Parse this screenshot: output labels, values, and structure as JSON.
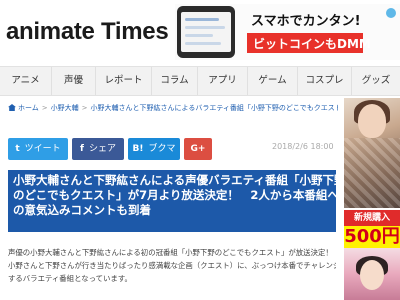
{
  "header": {
    "logo": "animate Times",
    "ad": {
      "line1": "スマホでカンタン!",
      "line2": "ビットコインもDMM"
    }
  },
  "nav": {
    "items": [
      "アニメ",
      "声優",
      "レポート",
      "コラム",
      "アプリ",
      "ゲーム",
      "コスプレ",
      "グッズ"
    ]
  },
  "breadcrumb": {
    "home": "ホーム",
    "sep": ">",
    "level1": "小野大輔",
    "level2": "小野大輔さんと下野紘さんによるバラエティ番組「小野下野のどこでもクエスト」が7月より放送決定"
  },
  "share": {
    "tweet": "ツイート",
    "facebook": "シェア",
    "hatena": "ブクマ",
    "gplus_icon": "G+",
    "twitter_icon": "t",
    "facebook_icon": "f",
    "hatena_icon": "B!",
    "colors": {
      "twitter": "#2f9ee6",
      "facebook": "#3b5997",
      "hatena": "#1a8ad8",
      "gplus": "#dc4e41"
    }
  },
  "article": {
    "date": "2018/2/6 18:00",
    "title_lines": [
      "小野大輔さんと下野紘さんによる声優バラエティ番組「小野下野",
      "のどこでもクエスト」が7月より放送決定！　2人から本番組へ",
      "の意気込みコメントも到着"
    ],
    "body_lines": [
      "声優の小野大輔さんと下野紘さんによる初の冠番組「小野下野のどこでもクエスト」が放送決定！",
      "小野さんと下野さんが行き当たりばったり感満載な企画（クエスト）に、ぶっつけ本番でチャレンジ",
      "するバラエティ番組となっています。"
    ],
    "title_bg": "#1d59a9"
  },
  "side_ad": {
    "banner": "新規購入",
    "price": "500円"
  }
}
